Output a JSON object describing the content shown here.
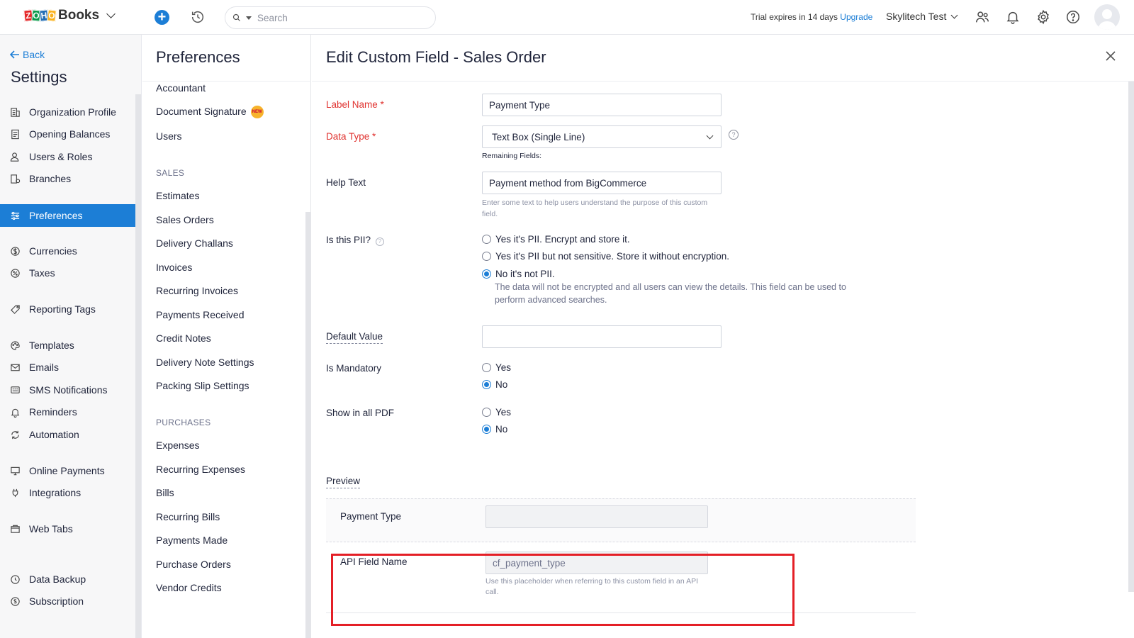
{
  "topbar": {
    "brand": {
      "z": "Z",
      "o1": "O",
      "h": "H",
      "o2": "O",
      "product": "Books"
    },
    "search_placeholder": "Search",
    "trial_text": "Trial expires in 14 days",
    "upgrade_label": "Upgrade",
    "org_name": "Skylitech Test"
  },
  "sidebar": {
    "back_label": "Back",
    "title": "Settings",
    "items": [
      {
        "label": "Organization Profile",
        "icon": "building-icon"
      },
      {
        "label": "Opening Balances",
        "icon": "ledger-icon"
      },
      {
        "label": "Users & Roles",
        "icon": "users-icon"
      },
      {
        "label": "Branches",
        "icon": "branch-icon"
      },
      {
        "label": "Preferences",
        "icon": "sliders-icon",
        "active": true
      },
      {
        "label": "Currencies",
        "icon": "currency-icon"
      },
      {
        "label": "Taxes",
        "icon": "percent-icon"
      },
      {
        "label": "Reporting Tags",
        "icon": "tag-icon"
      },
      {
        "label": "Templates",
        "icon": "palette-icon"
      },
      {
        "label": "Emails",
        "icon": "mail-icon"
      },
      {
        "label": "SMS Notifications",
        "icon": "sms-icon"
      },
      {
        "label": "Reminders",
        "icon": "bell-icon"
      },
      {
        "label": "Automation",
        "icon": "refresh-icon"
      },
      {
        "label": "Online Payments",
        "icon": "monitor-icon"
      },
      {
        "label": "Integrations",
        "icon": "plug-icon"
      },
      {
        "label": "Web Tabs",
        "icon": "tabs-icon"
      },
      {
        "label": "Data Backup",
        "icon": "backup-icon"
      },
      {
        "label": "Subscription",
        "icon": "subscription-icon"
      }
    ]
  },
  "preferences": {
    "title": "Preferences",
    "items": [
      "Accountant",
      "Document Signature",
      "Users"
    ],
    "new_badge": "NEW",
    "sales_heading": "SALES",
    "sales_items": [
      "Estimates",
      "Sales Orders",
      "Delivery Challans",
      "Invoices",
      "Recurring Invoices",
      "Payments Received",
      "Credit Notes",
      "Delivery Note Settings",
      "Packing Slip Settings"
    ],
    "purchases_heading": "PURCHASES",
    "purchases_items": [
      "Expenses",
      "Recurring Expenses",
      "Bills",
      "Recurring Bills",
      "Payments Made",
      "Purchase Orders",
      "Vendor Credits"
    ]
  },
  "form": {
    "title": "Edit Custom Field - Sales Order",
    "label_name": {
      "label": "Label Name *",
      "value": "Payment Type"
    },
    "data_type": {
      "label": "Data Type *",
      "value": "Text Box (Single Line)",
      "remaining": "Remaining Fields:"
    },
    "help_text": {
      "label": "Help Text",
      "value": "Payment method from BigCommerce",
      "hint": "Enter some text to help users understand the purpose of this custom field."
    },
    "pii": {
      "label": "Is this PII?",
      "options": [
        "Yes it's PII. Encrypt and store it.",
        "Yes it's PII but not sensitive. Store it without encryption.",
        "No it's not PII."
      ],
      "selected": 2,
      "description": "The data will not be encrypted and all users can view the details. This field can be used to perform advanced searches."
    },
    "default_value": {
      "label": "Default Value",
      "value": ""
    },
    "is_mandatory": {
      "label": "Is Mandatory",
      "options": [
        "Yes",
        "No"
      ],
      "selected": 1
    },
    "show_in_pdf": {
      "label": "Show in all PDF",
      "options": [
        "Yes",
        "No"
      ],
      "selected": 1
    },
    "preview": {
      "heading": "Preview",
      "field_label": "Payment Type",
      "api_label": "API Field Name",
      "api_value": "cf_payment_type",
      "api_hint": "Use this placeholder when referring to this custom field in an API call."
    }
  }
}
